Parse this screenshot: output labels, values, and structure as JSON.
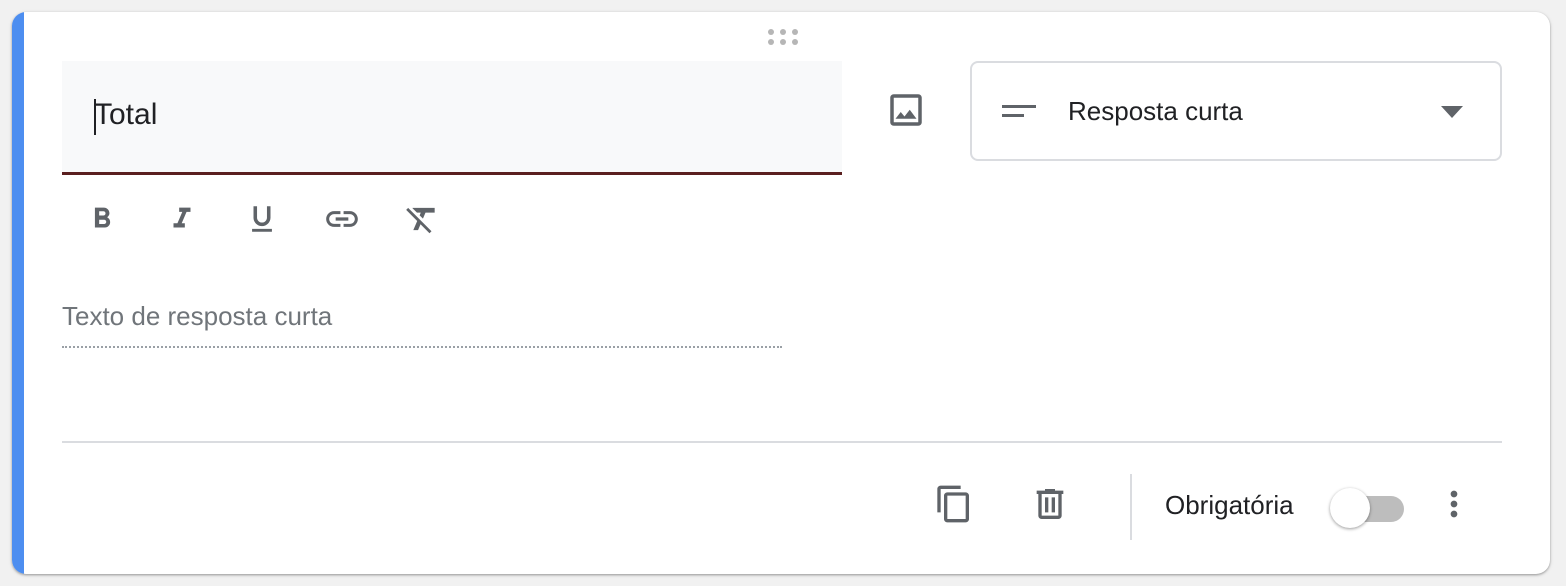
{
  "question": {
    "title_value": "Total",
    "type_selected": "Resposta curta",
    "answer_placeholder": "Texto de resposta curta",
    "required_label": "Obrigatória",
    "required": false
  },
  "icons": {
    "drag": "drag-handle-icon",
    "image": "image-icon",
    "type": "short-answer-icon",
    "dropdown": "arrow-drop-down-icon",
    "bold": "format-bold-icon",
    "italic": "format-italic-icon",
    "underline": "format-underline-icon",
    "link": "link-icon",
    "clear": "format-clear-icon",
    "copy": "copy-icon",
    "delete": "delete-icon",
    "more": "more-vert-icon"
  },
  "colors": {
    "accent": "#4d8ef0",
    "title_underline": "#5a1f1f",
    "icon": "#5f6368",
    "toggle_track": "#bdbdbd"
  }
}
